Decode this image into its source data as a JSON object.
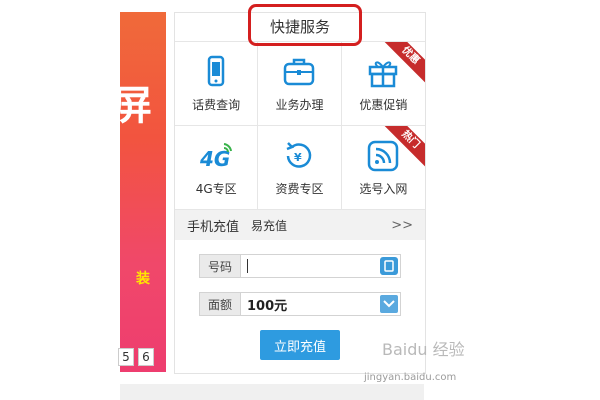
{
  "banner": {
    "glyph": "屏",
    "small_text": "装",
    "pages": [
      "5",
      "6"
    ]
  },
  "panel": {
    "title": "快捷服务",
    "services": [
      {
        "label": "话费查询",
        "icon": "phone-icon",
        "ribbon": ""
      },
      {
        "label": "业务办理",
        "icon": "briefcase-icon",
        "ribbon": ""
      },
      {
        "label": "优惠促销",
        "icon": "gift-icon",
        "ribbon": "优惠"
      },
      {
        "label": "4G专区",
        "icon": "4g-icon",
        "ribbon": ""
      },
      {
        "label": "资费专区",
        "icon": "refresh-coin-icon",
        "ribbon": ""
      },
      {
        "label": "选号入网",
        "icon": "wifi-signal-icon",
        "ribbon": "热门"
      }
    ],
    "recharge": {
      "tab_mobile": "手机充值",
      "tab_easy": "易充值",
      "more": ">>",
      "number_label": "号码",
      "number_value": "",
      "amount_label": "面额",
      "amount_value": "100元",
      "submit_label": "立即充值"
    }
  },
  "watermark": {
    "text": "Baidu 经验",
    "sub": "jingyan.baidu.com"
  },
  "colors": {
    "accent": "#1a8bd6",
    "highlight": "#d41f1f",
    "ribbon": "#c62c2c",
    "button": "#2e9be0"
  }
}
